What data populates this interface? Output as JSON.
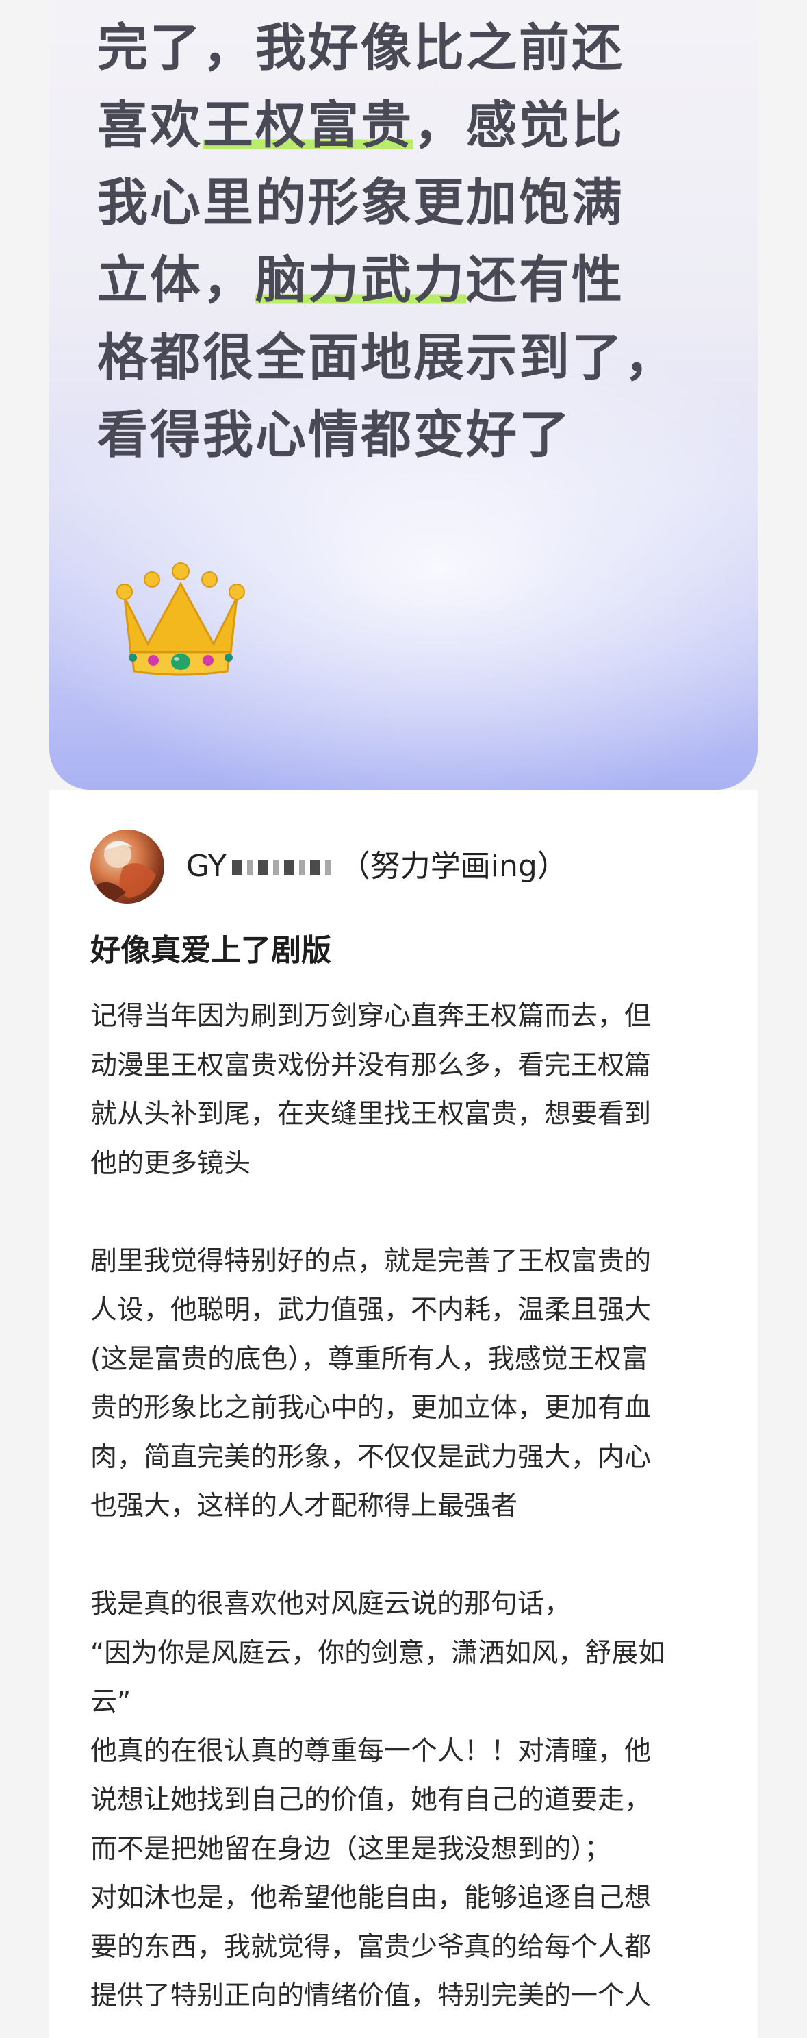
{
  "quote_card": {
    "lines": [
      {
        "before": "完了，我好像比之前还",
        "highlight": "",
        "after": ""
      },
      {
        "before": "喜欢",
        "highlight": "王权富贵",
        "after": "，感觉比"
      },
      {
        "before": "我心里的形象更加饱满",
        "highlight": "",
        "after": ""
      },
      {
        "before": "立体，",
        "highlight": "脑力武力",
        "after": "还有性"
      },
      {
        "before": "格都很全面地展示到了，",
        "highlight": "",
        "after": ""
      },
      {
        "before": "看得我心情都变好了",
        "highlight": "",
        "after": ""
      }
    ],
    "emoji": "crown-icon",
    "highlight_color": "#b9ec6a"
  },
  "post": {
    "author": {
      "name_prefix": "GY",
      "name_suffix": "（努力学画ing）"
    },
    "title": "好像真爱上了剧版",
    "paragraphs": [
      [
        "记得当年因为刷到万剑穿心直奔王权篇而去，但",
        "动漫里王权富贵戏份并没有那么多，看完王权篇",
        "就从头补到尾，在夹缝里找王权富贵，想要看到",
        "他的更多镜头"
      ],
      [
        "剧里我觉得特别好的点，就是完善了王权富贵的",
        "人设，他聪明，武力值强，不内耗，温柔且强大",
        "(这是富贵的底色），尊重所有人，我感觉王权富",
        "贵的形象比之前我心中的，更加立体，更加有血",
        "肉，简直完美的形象，不仅仅是武力强大，内心",
        "也强大，这样的人才配称得上最强者"
      ],
      [
        "我是真的很喜欢他对风庭云说的那句话，",
        "“因为你是风庭云，你的剑意，潇洒如风，舒展如",
        "云”",
        "他真的在很认真的尊重每一个人！！对清瞳，他",
        "说想让她找到自己的价值，她有自己的道要走，",
        "而不是把她留在身边（这里是我没想到的）；",
        "对如沐也是，他希望他能自由，能够追逐自己想",
        "要的东西，我就觉得，富贵少爷真的给每个人都",
        "提供了特别正向的情绪价值，特别完美的一个人"
      ]
    ]
  }
}
